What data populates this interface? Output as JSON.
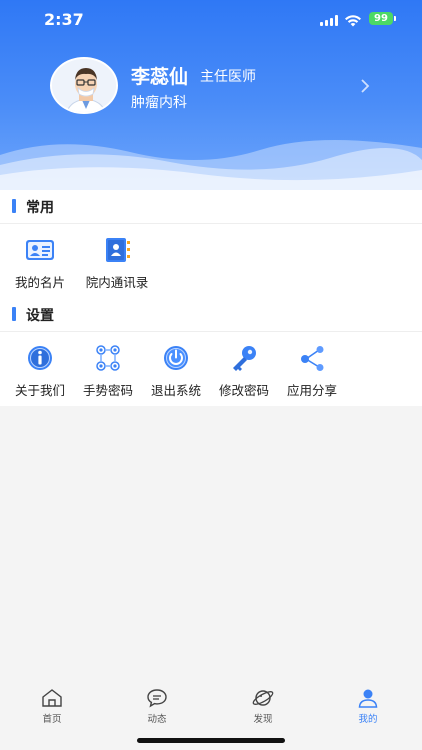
{
  "status_bar": {
    "time": "2:37",
    "battery": "99"
  },
  "profile": {
    "name": "李蕊仙",
    "title": "主任医师",
    "department": "肿瘤内科"
  },
  "sections": {
    "common": {
      "label": "常用",
      "items": [
        {
          "label": "我的名片",
          "icon": "business-card-icon"
        },
        {
          "label": "院内通讯录",
          "icon": "contacts-book-icon"
        }
      ]
    },
    "settings": {
      "label": "设置",
      "items": [
        {
          "label": "关于我们",
          "icon": "info-icon"
        },
        {
          "label": "手势密码",
          "icon": "gesture-pattern-icon"
        },
        {
          "label": "退出系统",
          "icon": "power-icon"
        },
        {
          "label": "修改密码",
          "icon": "key-icon"
        },
        {
          "label": "应用分享",
          "icon": "share-icon"
        }
      ]
    }
  },
  "tabbar": {
    "items": [
      {
        "label": "首页",
        "icon": "home-icon"
      },
      {
        "label": "动态",
        "icon": "chat-bubble-icon"
      },
      {
        "label": "发现",
        "icon": "planet-icon"
      },
      {
        "label": "我的",
        "icon": "user-icon",
        "active": true
      }
    ]
  },
  "colors": {
    "accent": "#3b82f6",
    "header_top": "#2f78f5",
    "header_bottom": "#6ea6fb"
  }
}
